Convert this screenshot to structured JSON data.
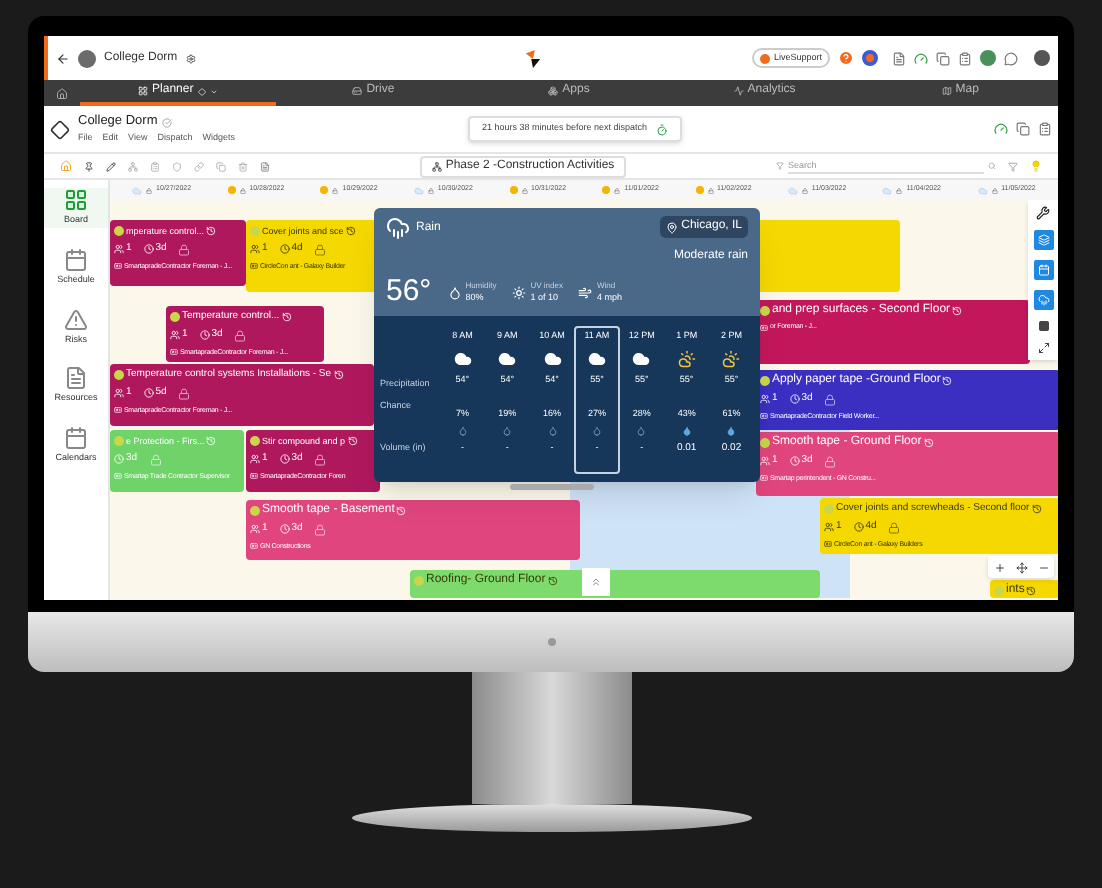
{
  "top_bar": {
    "project": "College Dorm",
    "live_support": "LiveSupport"
  },
  "nav": {
    "tabs": [
      {
        "label": "Planner",
        "selected": true
      },
      {
        "label": "Drive",
        "selected": false
      },
      {
        "label": "Apps",
        "selected": false
      },
      {
        "label": "Analytics",
        "selected": false
      },
      {
        "label": "Map",
        "selected": false
      }
    ]
  },
  "header": {
    "title": "College Dorm",
    "menu": [
      "File",
      "Edit",
      "View",
      "Dispatch",
      "Widgets"
    ],
    "dispatch_notice": "21 hours 38 minutes before next dispatch"
  },
  "toolbar": {
    "phase": "Phase 2 -Construction Activities",
    "search": {
      "placeholder": "Search"
    }
  },
  "sidebar": [
    {
      "label": "Board",
      "selected": true
    },
    {
      "label": "Schedule",
      "selected": false
    },
    {
      "label": "Risks",
      "selected": false
    },
    {
      "label": "Resources",
      "selected": false
    },
    {
      "label": "Calendars",
      "selected": false
    }
  ],
  "timeline": {
    "dates": [
      {
        "date": "10/27/2022",
        "kind": "cloud"
      },
      {
        "date": "10/28/2022",
        "kind": "sun"
      },
      {
        "date": "10/29/2022",
        "kind": "sun"
      },
      {
        "date": "10/30/2022",
        "kind": "cloud"
      },
      {
        "date": "10/31/2022",
        "kind": "sun"
      },
      {
        "date": "11/01/2022",
        "kind": "sun"
      },
      {
        "date": "11/02/2022",
        "kind": "sun"
      },
      {
        "date": "11/03/2022",
        "kind": "cloud"
      },
      {
        "date": "11/04/2022",
        "kind": "cloud"
      },
      {
        "date": "11/05/2022",
        "kind": "cloud"
      }
    ]
  },
  "tasks": [
    {
      "title": "mperature control...",
      "count": "1",
      "duration": "3d",
      "assignee": "SmartapradeContractor Foreman - J...",
      "color": "#b0185e"
    },
    {
      "title": "Cover joints and sce",
      "count": "1",
      "duration": "4d",
      "assignee": "CircleCon  ant - Galaxy Builder",
      "color": "#f5d800"
    },
    {
      "title": "Temperature control...",
      "count": "1",
      "duration": "3d",
      "assignee": "SmartapradeContractor Foreman - J...",
      "color": "#b0185e"
    },
    {
      "title": "Temperature control systems Installations - Se",
      "count": "1",
      "duration": "5d",
      "assignee": "SmartapradeContractor Foreman - J...",
      "color": "#b0185e"
    },
    {
      "title": "e Protection - Firs...",
      "duration": "3d",
      "assignee": "Smartap Trade Contractor Supervisor",
      "color": "#6fd36a"
    },
    {
      "title": "Stir compound and p",
      "count": "1",
      "duration": "3d",
      "assignee": "SmartapradeContractor Foren",
      "color": "#b0185e"
    },
    {
      "title": "Smooth tape - Basement",
      "count": "1",
      "duration": "3d",
      "assignee": "GN Constructions",
      "color": "#e0457e"
    },
    {
      "title": "Roofing- Ground Floor",
      "color": "#7ddb6e"
    },
    {
      "title": "and prep surfaces - Second Floor",
      "assignee": "or Foreman - J...",
      "color": "#c2185b"
    },
    {
      "title": "Apply paper tape -Ground Floor",
      "count": "1",
      "duration": "3d",
      "assignee": "SmartapradeContractor Field Worker...",
      "color": "#3a2fc0"
    },
    {
      "title": "Smooth tape - Ground Floor",
      "count": "1",
      "duration": "3d",
      "assignee": "Smartap perintendent - GN Constru...",
      "color": "#e0457e"
    },
    {
      "title": "Cover joints and screwheads - Second floor",
      "count": "1",
      "duration": "4d",
      "assignee": "CircleCon  ant - Galaxy Builders",
      "color": "#f5d800"
    },
    {
      "title": "ints",
      "color": "#f5d800"
    }
  ],
  "weather": {
    "condition": "Rain",
    "location": "Chicago, IL",
    "temperature": "56°",
    "summary": "Moderate rain",
    "stats": [
      {
        "kind": "humidity",
        "label": "Humidity",
        "value": "80%"
      },
      {
        "kind": "uv",
        "label": "UV index",
        "value": "1 of 10"
      },
      {
        "kind": "wind",
        "label": "Wind",
        "value": "4 mph"
      }
    ],
    "row_labels": {
      "precipitation": "Precipitation",
      "chance": "Chance",
      "volume": "Volume (in)"
    },
    "hours": [
      {
        "time": "8 AM",
        "kind": "cloudy",
        "temp": "54°",
        "chance": "7%",
        "volume": "-",
        "selected": false
      },
      {
        "time": "9 AM",
        "kind": "cloudy",
        "temp": "54°",
        "chance": "19%",
        "volume": "-",
        "selected": false
      },
      {
        "time": "10 AM",
        "kind": "cloudy",
        "temp": "54°",
        "chance": "16%",
        "volume": "-",
        "selected": false
      },
      {
        "time": "11 AM",
        "kind": "cloudy",
        "temp": "55°",
        "chance": "27%",
        "volume": "-",
        "selected": true
      },
      {
        "time": "12 PM",
        "kind": "cloudy",
        "temp": "55°",
        "chance": "28%",
        "volume": "-",
        "selected": false
      },
      {
        "time": "1 PM",
        "kind": "showers",
        "temp": "55°",
        "chance": "43%",
        "volume": "0.01",
        "selected": false
      },
      {
        "time": "2 PM",
        "kind": "showers",
        "temp": "55°",
        "chance": "61%",
        "volume": "0.02",
        "selected": false
      }
    ]
  }
}
